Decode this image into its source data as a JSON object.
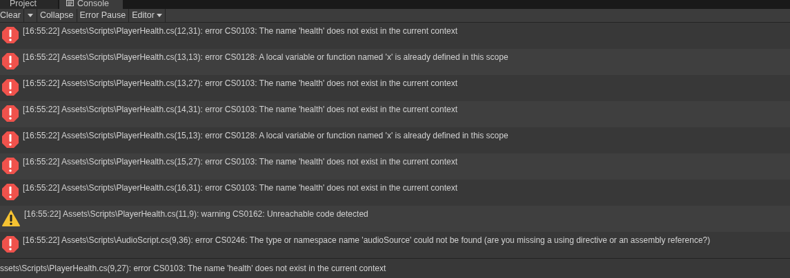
{
  "tabs": [
    {
      "label": "Project",
      "selected": false
    },
    {
      "label": "Console",
      "selected": true
    }
  ],
  "toolbar": {
    "buttons": [
      {
        "label": "Clear",
        "kind": "button"
      },
      {
        "label": "Collapse",
        "kind": "button"
      },
      {
        "label": "Error Pause",
        "kind": "button"
      },
      {
        "label": "Editor",
        "kind": "dropdown"
      }
    ]
  },
  "messages": [
    {
      "kind": "error",
      "text": "[16:55:22] Assets\\Scripts\\PlayerHealth.cs(12,31): error CS0103: The name 'health' does not exist in the current context"
    },
    {
      "kind": "error",
      "text": "[16:55:22] Assets\\Scripts\\PlayerHealth.cs(13,13): error CS0128: A local variable or function named 'x' is already defined in this scope"
    },
    {
      "kind": "error",
      "text": "[16:55:22] Assets\\Scripts\\PlayerHealth.cs(13,27): error CS0103: The name 'health' does not exist in the current context"
    },
    {
      "kind": "error",
      "text": "[16:55:22] Assets\\Scripts\\PlayerHealth.cs(14,31): error CS0103: The name 'health' does not exist in the current context"
    },
    {
      "kind": "error",
      "text": "[16:55:22] Assets\\Scripts\\PlayerHealth.cs(15,13): error CS0128: A local variable or function named 'x' is already defined in this scope"
    },
    {
      "kind": "error",
      "text": "[16:55:22] Assets\\Scripts\\PlayerHealth.cs(15,27): error CS0103: The name 'health' does not exist in the current context"
    },
    {
      "kind": "error",
      "text": "[16:55:22] Assets\\Scripts\\PlayerHealth.cs(16,31): error CS0103: The name 'health' does not exist in the current context"
    },
    {
      "kind": "warning",
      "text": "[16:55:22] Assets\\Scripts\\PlayerHealth.cs(11,9): warning CS0162: Unreachable code detected"
    },
    {
      "kind": "error",
      "text": "[16:55:22] Assets\\Scripts\\AudioScript.cs(9,36): error CS0246: The type or namespace name 'audioSource' could not be found (are you missing a using directive or an assembly reference?)"
    }
  ],
  "status_bar": {
    "text": "ssets\\Scripts\\PlayerHealth.cs(9,27): error CS0103: The name 'health' does not exist in the current context"
  }
}
